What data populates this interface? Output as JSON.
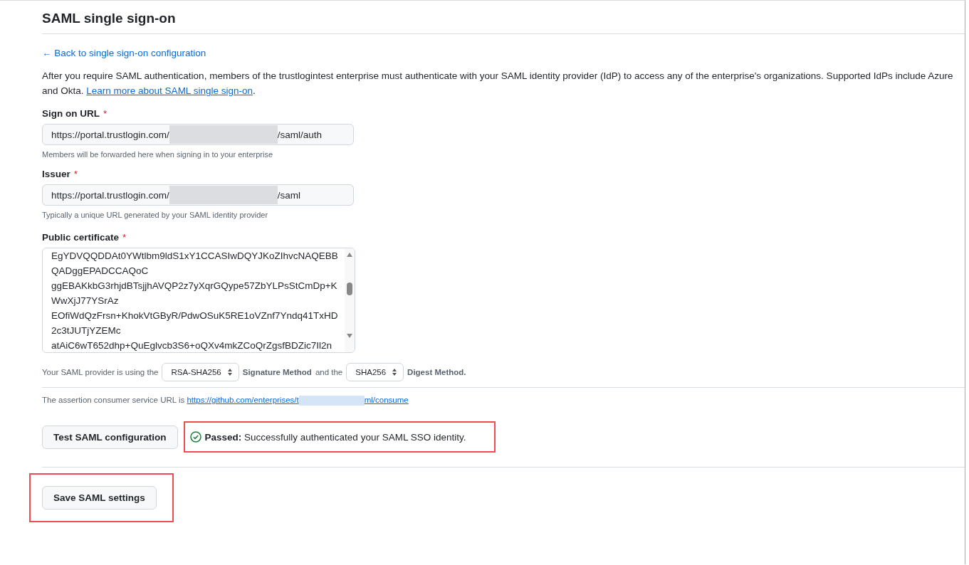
{
  "page": {
    "title": "SAML single sign-on"
  },
  "back_link": "← Back to single sign-on configuration",
  "intro": {
    "text": "After you require SAML authentication, members of the trustlogintest enterprise must authenticate with your SAML identity provider (IdP) to access any of the enterprise's organizations. Supported IdPs include Azure and Okta.",
    "link": "Learn more about SAML single sign-on",
    "end": "."
  },
  "fields": [
    {
      "label": "Sign on URL",
      "required_mark": "*",
      "value_start": "https://portal.trustlogin.com/",
      "redacted": true,
      "value_end": "/saml/auth",
      "hint": "Members will be forwarded here when signing in to your enterprise"
    },
    {
      "label": "Issuer",
      "required_mark": "*",
      "value_start": "https://portal.trustlogin.com/",
      "redacted": true,
      "value_end": "/saml",
      "hint": "Typically a unique URL generated by your SAML identity provider"
    }
  ],
  "certificate": {
    "label": "Public certificate",
    "required_mark": "*",
    "lines": [
      "EgYDVQQDDAt0YWtlbm9ldS1xY1CCASIwDQYJKoZIhvcNAQEBB",
      "QADggEPADCCAQoC",
      "ggEBAKkbG3rhjdBTsjjhAVQP2z7yXqrGQype57ZbYLPsStCmDp+K",
      "WwXjJ77YSrAz",
      "EOfiWdQzFrsn+KhokVtGByR/PdwOSuK5RE1oVZnf7Yndq41TxHD",
      "2c3tJUTjYZEMc",
      "atAiC6wT652dhp+QuEglvcb3S6+oQXv4mkZCoQrZgsfBDZic7Il2n"
    ]
  },
  "methods": {
    "text_1": "Your SAML provider is using the",
    "signature_select": "RSA-SHA256",
    "signature_label": "Signature Method",
    "text_2": "and the",
    "digest_select": "SHA256",
    "digest_label": "Digest Method",
    "text_3": "."
  },
  "acs": {
    "text": "The assertion consumer service URL is",
    "link_start": "https://github.com/enterprises/t",
    "redacted": true,
    "link_end": "ml/consume"
  },
  "test": {
    "button": "Test SAML configuration",
    "status": "Passed:",
    "message": "Successfully authenticated your SAML SSO identity.",
    "highlighted": true
  },
  "save": {
    "button": "Save SAML settings",
    "highlighted": true
  }
}
